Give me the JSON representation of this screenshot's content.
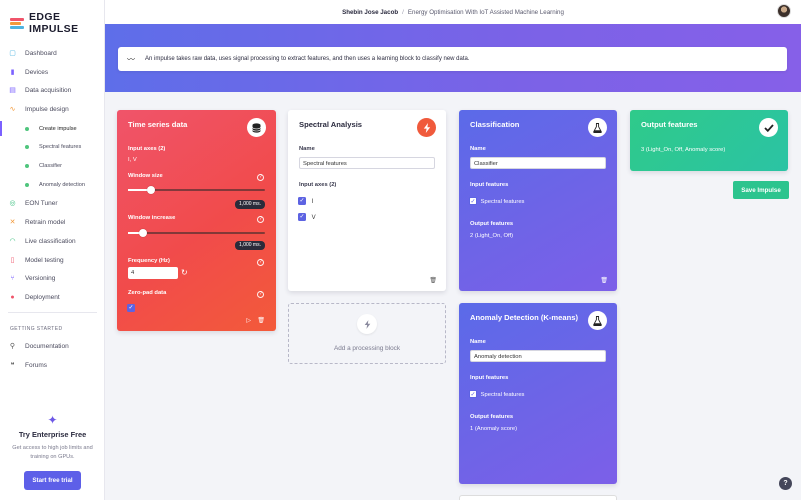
{
  "app": {
    "logo_text": "EDGE IMPULSE"
  },
  "topbar": {
    "user": "Shebin Jose Jacob",
    "separator": "/",
    "project": "Energy Optimisation With IoT Assisted Machine Learning"
  },
  "sidebar": {
    "items": [
      {
        "label": "Dashboard",
        "icon": "dashboard-icon",
        "color": "#4fb3e0"
      },
      {
        "label": "Devices",
        "icon": "devices-icon",
        "color": "#7b61ff"
      },
      {
        "label": "Data acquisition",
        "icon": "data-icon",
        "color": "#7b61ff"
      },
      {
        "label": "Impulse design",
        "icon": "impulse-icon",
        "color": "#f39a3c"
      }
    ],
    "sub_items": [
      {
        "label": "Create impulse",
        "active": true
      },
      {
        "label": "Spectral features",
        "active": false
      },
      {
        "label": "Classifier",
        "active": false
      },
      {
        "label": "Anomaly detection",
        "active": false
      }
    ],
    "items2": [
      {
        "label": "EON Tuner",
        "icon": "eon-icon",
        "color": "#3bbf7f"
      },
      {
        "label": "Retrain model",
        "icon": "retrain-icon",
        "color": "#f39a3c"
      },
      {
        "label": "Live classification",
        "icon": "live-icon",
        "color": "#3bbf7f"
      },
      {
        "label": "Model testing",
        "icon": "testing-icon",
        "color": "#f0546a"
      },
      {
        "label": "Versioning",
        "icon": "versioning-icon",
        "color": "#7b61ff"
      },
      {
        "label": "Deployment",
        "icon": "deployment-icon",
        "color": "#f0546a"
      }
    ],
    "section_title": "GETTING STARTED",
    "getting_started": [
      {
        "label": "Documentation",
        "icon": "documentation-icon"
      },
      {
        "label": "Forums",
        "icon": "forums-icon"
      }
    ],
    "enterprise": {
      "title": "Try Enterprise Free",
      "description": "Get access to high job limits and training on GPUs.",
      "button": "Start free trial"
    }
  },
  "info_bar": {
    "text": "An impulse takes raw data, uses signal processing to extract features, and then uses a learning block to classify new data."
  },
  "time_series": {
    "title": "Time series data",
    "input_axes_label": "Input axes (2)",
    "input_axes_value": "I, V",
    "window_size_label": "Window size",
    "window_size_value": "1,000 ms.",
    "window_size_level": 0.17,
    "window_increase_label": "Window increase",
    "window_increase_value": "1,000 ms.",
    "window_increase_level": 0.11,
    "frequency_label": "Frequency (Hz)",
    "frequency_value": "4",
    "zero_pad_label": "Zero-pad data",
    "zero_pad_checked": true
  },
  "spectral": {
    "title": "Spectral Analysis",
    "name_label": "Name",
    "name_value": "Spectral features",
    "input_axes_label": "Input axes (2)",
    "axes": [
      "I",
      "V"
    ]
  },
  "add_block": {
    "label": "Add a processing block"
  },
  "classification": {
    "title": "Classification",
    "name_label": "Name",
    "name_value": "Classifier",
    "input_features_label": "Input features",
    "input_feature": "Spectral features",
    "output_features_label": "Output features",
    "output_features_value": "2 (Light_On, Off)"
  },
  "anomaly": {
    "title": "Anomaly Detection (K-means)",
    "name_label": "Name",
    "name_value": "Anomaly detection",
    "input_features_label": "Input features",
    "input_feature": "Spectral features",
    "output_features_label": "Output features",
    "output_features_value": "1 (Anomaly score)"
  },
  "output": {
    "title": "Output features",
    "value": "3 (Light_On, Off, Anomaly score)"
  },
  "save_button": "Save Impulse",
  "help_button": "?"
}
